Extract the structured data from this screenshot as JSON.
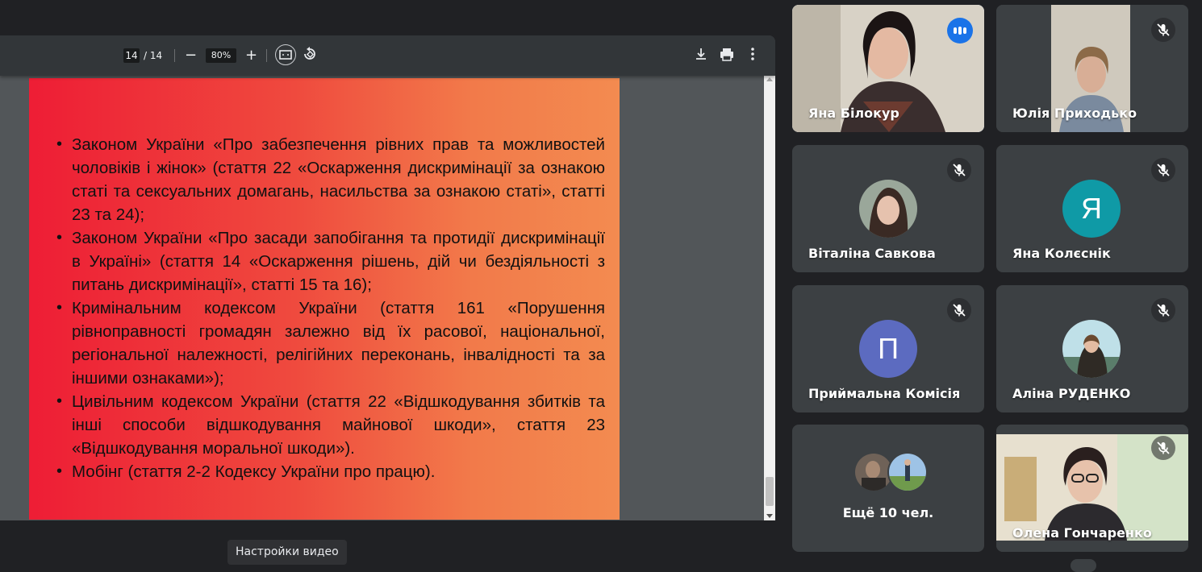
{
  "pdf_toolbar": {
    "page_current": "14",
    "page_total": "/ 14",
    "zoom": "80%",
    "zoom_out_symbol": "−",
    "zoom_in_symbol": "+",
    "icons": [
      "fit-page-icon",
      "rotate-icon",
      "download-icon",
      "print-icon",
      "more-vert-icon"
    ]
  },
  "slide": {
    "items": [
      "Законом України «Про забезпечення рівних прав та можливостей чоловіків і жінок» (стаття 22 «Оскарження дискримінації за ознакою статі та сексуальних домагань, насильства за ознакою статі», статті 23 та 24);",
      "Законом України «Про засади запобігання та протидії дискримінації в Україні» (стаття 14 «Оскарження рішень, дій чи бездіяльності з питань дискримінації», статті 15 та 16);",
      "Кримінальним кодексом України (стаття 161 «Порушення рівноправності громадян залежно від їх расової, національної, регіональної належності, релігійних переконань, інвалідності та за іншими ознаками»);",
      "Цивільним кодексом України (стаття 22 «Відшкодування збитків та інші способи відшкодування майнової шкоди», стаття 23 «Відшкодування моральної шкоди»).",
      "Мобінг (стаття 2-2 Кодексу України про працю)."
    ],
    "gradient_colors": [
      "#ee1d35",
      "#f38b50"
    ]
  },
  "video_settings_label": "Настройки видео",
  "participants": [
    {
      "name": "Яна Білокур",
      "state": "speaking",
      "video": true
    },
    {
      "name": "Юлія Приходько",
      "state": "muted",
      "video": true
    },
    {
      "name": "Віталіна Савкова",
      "state": "muted",
      "avatar": "photo"
    },
    {
      "name": "Яна Колєснік",
      "state": "muted",
      "avatar_letter": "Я",
      "avatar_color": "#0f9aa6"
    },
    {
      "name": "Приймальна Комісія",
      "state": "muted",
      "avatar_letter": "П",
      "avatar_color": "#5c6bc0"
    },
    {
      "name": "Аліна РУДЕНКО",
      "state": "muted",
      "avatar": "photo"
    },
    {
      "name": "Олена Гончаренко",
      "state": "muted",
      "video": true
    }
  ],
  "more_participants": "Ещё 10 чел.",
  "colors": {
    "active_border": "#8ab4f8",
    "speaking_badge": "#1a73e8",
    "tile_bg": "#3c4043",
    "page_bg": "#202124"
  }
}
